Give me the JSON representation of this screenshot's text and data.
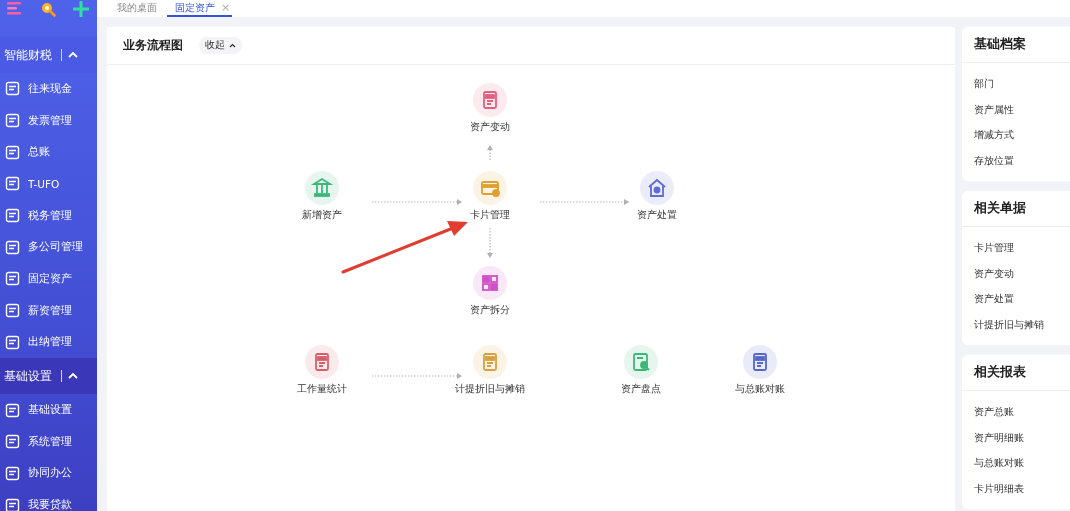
{
  "sidebar": {
    "sections": [
      {
        "title": "智能财税",
        "expanded": true,
        "items": [
          {
            "label": "往来现金"
          },
          {
            "label": "发票管理"
          },
          {
            "label": "总账"
          },
          {
            "label": "T-UFO"
          },
          {
            "label": "税务管理"
          },
          {
            "label": "多公司管理"
          },
          {
            "label": "固定资产"
          },
          {
            "label": "薪资管理"
          },
          {
            "label": "出纳管理"
          }
        ]
      },
      {
        "title": "基础设置",
        "expanded": true,
        "items": [
          {
            "label": "基础设置"
          },
          {
            "label": "系统管理"
          },
          {
            "label": "协同办公"
          },
          {
            "label": "我要贷款"
          }
        ]
      }
    ]
  },
  "tabs": [
    {
      "label": "我的桌面",
      "selected": false
    },
    {
      "label": "固定资产",
      "selected": true,
      "close": "×"
    }
  ],
  "flow": {
    "title": "业务流程图",
    "collapse": "收起",
    "nodes": [
      {
        "label": "资产变动",
        "kind": "document",
        "color": "#e0607e"
      },
      {
        "label": "新增资产",
        "kind": "bank",
        "color": "#3bb87a"
      },
      {
        "label": "卡片管理",
        "kind": "card",
        "color": "#e0a030"
      },
      {
        "label": "资产处置",
        "kind": "house",
        "color": "#5e6cd2"
      },
      {
        "label": "资产拆分",
        "kind": "grid",
        "color": "#d050c8"
      },
      {
        "label": "工作量统计",
        "kind": "document",
        "color": "#d8606a"
      },
      {
        "label": "计提折旧与摊销",
        "kind": "document",
        "color": "#d8a040"
      },
      {
        "label": "资产盘点",
        "kind": "magnifier",
        "color": "#3bb878"
      },
      {
        "label": "与总账对账",
        "kind": "document",
        "color": "#5866c8"
      }
    ]
  },
  "panels": [
    {
      "title": "基础档案",
      "items": [
        "部门",
        "资产属性",
        "增减方式",
        "存放位置"
      ]
    },
    {
      "title": "相关单据",
      "items": [
        "卡片管理",
        "资产变动",
        "资产处置",
        "计提折旧与摊销"
      ]
    },
    {
      "title": "相关报表",
      "items": [
        "资产总账",
        "资产明细账",
        "与总账对账",
        "卡片明细表"
      ]
    }
  ]
}
